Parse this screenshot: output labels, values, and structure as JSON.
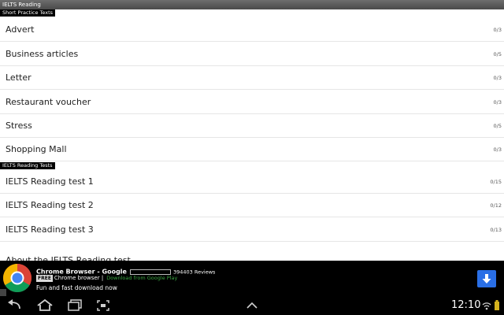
{
  "app": {
    "title": "IELTS Reading"
  },
  "sections": [
    {
      "header": "Short Practice Texts",
      "items": [
        {
          "label": "Advert",
          "count": "0/3"
        },
        {
          "label": "Business articles",
          "count": "0/5"
        },
        {
          "label": "Letter",
          "count": "0/3"
        },
        {
          "label": "Restaurant voucher",
          "count": "0/3"
        },
        {
          "label": "Stress",
          "count": "0/5"
        },
        {
          "label": "Shopping Mall",
          "count": "0/3"
        }
      ]
    },
    {
      "header": "IELTS Reading Tests",
      "items": [
        {
          "label": "IELTS Reading test 1",
          "count": "0/15"
        },
        {
          "label": "IELTS Reading test 2",
          "count": "0/12"
        },
        {
          "label": "IELTS Reading test 3",
          "count": "0/13"
        }
      ]
    }
  ],
  "partial_item": {
    "label": "About the IELTS Reading test"
  },
  "ad": {
    "title": "Chrome Browser - Google",
    "reviews": "394403 Reviews",
    "free_badge": "FREE",
    "app_name": "Chrome browser |",
    "link": "Download from Google Play",
    "tagline": "Fun and fast download now",
    "icon": "chrome-logo",
    "download_icon": "download-icon"
  },
  "status": {
    "time": "12:10"
  },
  "colors": {
    "ad_button": "#2a6fe6",
    "link_green": "#3aa441",
    "section_header_bg": "#000000"
  }
}
